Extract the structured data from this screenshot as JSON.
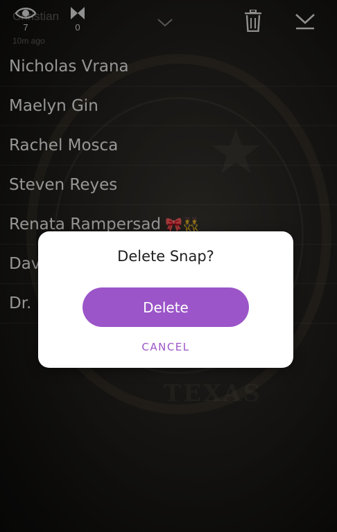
{
  "header": {
    "sender_name": "Christian",
    "time_ago": "10m ago",
    "views_count": "7",
    "screenshots_count": "0",
    "icons": {
      "views": "eye-icon",
      "screenshots": "screenshot-arrows-icon",
      "collapse": "chevron-down-icon",
      "delete": "trash-icon",
      "download": "download-icon"
    }
  },
  "viewers": [
    {
      "name": "Nicholas Vrana",
      "emoji": ""
    },
    {
      "name": "Maelyn Gin",
      "emoji": ""
    },
    {
      "name": "Rachel Mosca",
      "emoji": ""
    },
    {
      "name": "Steven Reyes",
      "emoji": ""
    },
    {
      "name": "Renata Rampersad",
      "emoji": "🎀👯"
    },
    {
      "name": "Dav",
      "emoji": ""
    },
    {
      "name": "Dr.",
      "emoji": ""
    }
  ],
  "background_text": "TEXAS",
  "dialog": {
    "title": "Delete Snap?",
    "delete_label": "Delete",
    "cancel_label": "CANCEL"
  },
  "colors": {
    "accent": "#9b55c8",
    "dialog_bg": "#ffffff"
  }
}
